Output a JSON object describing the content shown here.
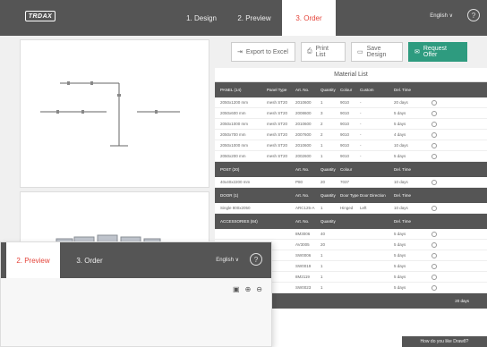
{
  "header": {
    "logo": "TRDAX",
    "tabs": [
      {
        "label": "1. Design"
      },
      {
        "label": "2. Preview"
      },
      {
        "label": "3. Order"
      }
    ],
    "language": "English ∨",
    "help": "?"
  },
  "toolbar": {
    "export": "Export to Excel",
    "print": "Print List",
    "save": "Save Design",
    "offer": "Request Offer"
  },
  "material_list": {
    "title": "Material List",
    "sections": [
      {
        "title": "PANEL (14)",
        "headers": [
          "Panel Type",
          "Art. No.",
          "Quantity",
          "Colour",
          "Custom",
          "Del. Time"
        ],
        "rows": [
          [
            "2050x1200 mm",
            "mesh ST20",
            "2010600",
            "1",
            "9010",
            "-",
            "20 days"
          ],
          [
            "2050x600 mm",
            "mesh ST20",
            "2008600",
            "3",
            "9010",
            "-",
            "5 days"
          ],
          [
            "2050x1000 mm",
            "mesh ST20",
            "2010600",
            "2",
            "9010",
            "-",
            "5 days"
          ],
          [
            "2050x700 mm",
            "mesh ST20",
            "2007600",
            "2",
            "9010",
            "-",
            "4 days"
          ],
          [
            "2050x1000 mm",
            "mesh ST20",
            "2010600",
            "1",
            "9010",
            "-",
            "10 days"
          ],
          [
            "2050x200 mm",
            "mesh ST20",
            "2002600",
            "1",
            "9010",
            "-",
            "5 days"
          ]
        ]
      },
      {
        "title": "POST (20)",
        "headers": [
          "",
          "Art. No.",
          "Quantity",
          "Colour",
          "",
          "Del. Time"
        ],
        "rows": [
          [
            "40x40x2200 mm",
            "",
            "P80",
            "20",
            "7037",
            "",
            "10 days"
          ]
        ]
      },
      {
        "title": "DOOR (1)",
        "headers": [
          "",
          "Art. No.",
          "Quantity",
          "Door Type",
          "Door Direction",
          "Del. Time"
        ],
        "rows": [
          [
            "Single 800x2050",
            "",
            "ARC125-A",
            "1",
            "Hinged",
            "Left",
            "10 days"
          ]
        ]
      },
      {
        "title": "ACCESSORIES (84)",
        "headers": [
          "",
          "Art. No.",
          "Quantity",
          "",
          "",
          "Del. Time"
        ],
        "rows": [
          [
            "",
            "",
            "8M3006",
            "40",
            "",
            "",
            "5 days"
          ],
          [
            "",
            "",
            "AV3005",
            "20",
            "",
            "",
            "5 days"
          ],
          [
            "",
            "",
            "SW0006",
            "1",
            "",
            "",
            "5 days"
          ],
          [
            "",
            "",
            "SW0019",
            "1",
            "",
            "",
            "5 days"
          ],
          [
            "",
            "",
            "8M2119",
            "1",
            "",
            "",
            "5 days"
          ],
          [
            "",
            "",
            "SW0023",
            "1",
            "",
            "",
            "5 days"
          ]
        ]
      }
    ],
    "total": "20 days"
  },
  "preview_window": {
    "tabs": [
      {
        "label": "2. Preview"
      },
      {
        "label": "3. Order"
      }
    ],
    "language": "English ∨",
    "help": "?"
  },
  "feedback": "How do you like Draw8?"
}
